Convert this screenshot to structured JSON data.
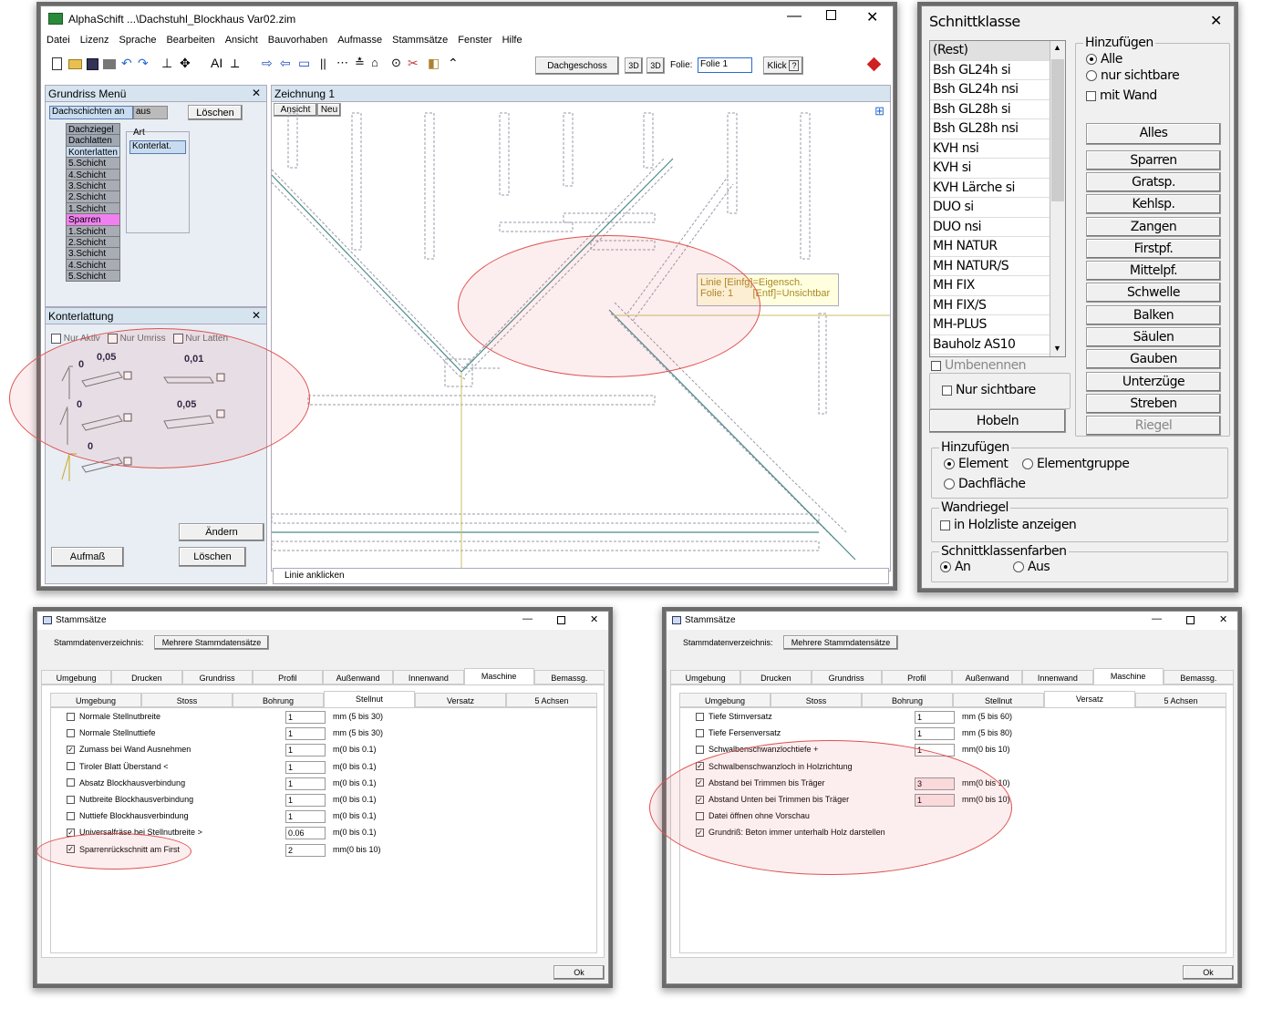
{
  "main": {
    "title": "AlphaSchift ...\\Dachstuhl_Blockhaus Var02.zim",
    "menu": [
      "Datei",
      "Lizenz",
      "Sprache",
      "Bearbeiten",
      "Ansicht",
      "Bauvorhaben",
      "Aufmasse",
      "Stammsätze",
      "Fenster",
      "Hilfe"
    ],
    "toolbar": {
      "floor": "Dachgeschoss",
      "btn3d1": "3D",
      "btn3d2": "3D",
      "folie_label": "Folie:",
      "folie_value": "Folie 1",
      "klick": "Klick",
      "help": "?"
    },
    "grundriss": {
      "title": "Grundriss Menü",
      "dachschichten": "Dachschichten an",
      "aus": "aus",
      "loeschen": "Löschen",
      "layers": [
        "Dachziegel",
        "Dachlatten",
        "Konterlatten",
        "5.Schicht",
        "4.Schicht",
        "3.Schicht",
        "2.Schicht",
        "1.Schicht",
        "Sparren",
        "1.Schicht",
        "2.Schicht",
        "3.Schicht",
        "4.Schicht",
        "5.Schicht"
      ],
      "art_label": "Art",
      "art_value": "Konterlat."
    },
    "konter": {
      "title": "Konterlattung",
      "nur_aktiv": "Nur Aktiv",
      "nur_umriss": "Nur Umriss",
      "nur_latten": "Nur Latten",
      "vals": [
        "0",
        "0,05",
        "0,01",
        "0",
        "0,05",
        "0"
      ],
      "aendern": "Ändern",
      "aufmass": "Aufmaß",
      "loeschen": "Löschen"
    },
    "zeichnung": {
      "title": "Zeichnung 1",
      "ansicht": "Ansicht",
      "neu": "Neu",
      "tip1": "Linie  [Einfg]=Eigensch.",
      "tip2": "Folie: 1       [Entf]=Unsichtbar",
      "status": "Linie anklicken"
    }
  },
  "schnitt": {
    "title": "Schnittklasse",
    "items": [
      "(Rest)",
      "Bsh GL24h si",
      "Bsh GL24h nsi",
      "Bsh GL28h si",
      "Bsh GL28h nsi",
      "KVH nsi",
      "KVH si",
      "KVH Lärche si",
      "DUO si",
      "DUO nsi",
      "MH NATUR",
      "MH NATUR/S",
      "MH FIX",
      "MH FIX/S",
      "MH-PLUS",
      "Bauholz AS10"
    ],
    "hinzufuegen": "Hinzufügen",
    "alle": "Alle",
    "nur_sichtbare": "nur sichtbare",
    "mit_wand": "mit Wand",
    "buttons": [
      "Alles",
      "Sparren",
      "Gratsp.",
      "Kehlsp.",
      "Zangen",
      "Firstpf.",
      "Mittelpf.",
      "Schwelle",
      "Balken",
      "Säulen",
      "Gauben",
      "Unterzüge",
      "Streben",
      "Riegel"
    ],
    "umbenennen": "Umbenennen",
    "nur_sichtbare2": "Nur sichtbare",
    "hobeln": "Hobeln",
    "hinz2": "Hinzufügen",
    "element": "Element",
    "elementgruppe": "Elementgruppe",
    "dachflaeche": "Dachfläche",
    "wandriegel": "Wandriegel",
    "holzliste": "in Holzliste anzeigen",
    "farben": "Schnittklassenfarben",
    "an": "An",
    "aus": "Aus"
  },
  "stamm1": {
    "title": "Stammsätze",
    "verz": "Stammdatenverzeichnis:",
    "mehrere": "Mehrere Stammdatensätze",
    "tabs": [
      "Umgebung",
      "Drucken",
      "Grundriss",
      "Profil",
      "Außenwand",
      "Innenwand",
      "Maschine",
      "Bemassg."
    ],
    "subtabs": [
      "Umgebung",
      "Stoss",
      "Bohrung",
      "Stellnut",
      "Versatz",
      "5 Achsen"
    ],
    "rows": [
      {
        "label": "Normale Stellnutbreite",
        "checked": "",
        "value": "1",
        "unit": "mm (5 bis 30)"
      },
      {
        "label": "Normale Stellnuttiefe",
        "checked": "",
        "value": "1",
        "unit": "mm (5 bis 30)"
      },
      {
        "label": "Zumass bei Wand Ausnehmen",
        "checked": "✓",
        "value": "1",
        "unit": "m(0 bis 0.1)"
      },
      {
        "label": "Tiroler Blatt  Überstand <",
        "checked": "",
        "value": "1",
        "unit": "m(0 bis 0.1)"
      },
      {
        "label": "Absatz Blockhausverbindung",
        "checked": "",
        "value": "1",
        "unit": "m(0 bis 0.1)"
      },
      {
        "label": "Nutbreite Blockhausverbindung",
        "checked": "",
        "value": "1",
        "unit": "m(0 bis 0.1)"
      },
      {
        "label": "Nuttiefe Blockhausverbindung",
        "checked": "",
        "value": "1",
        "unit": "m(0 bis 0.1)"
      },
      {
        "label": "Universalfräse bei Stellnutbreite >",
        "checked": "✓",
        "value": "0.06",
        "unit": "m(0 bis 0.1)"
      },
      {
        "label": "Sparrenrückschnitt am First",
        "checked": "✓",
        "value": "2",
        "unit": "mm(0 bis 10)"
      }
    ],
    "ok": "Ok"
  },
  "stamm2": {
    "title": "Stammsätze",
    "verz": "Stammdatenverzeichnis:",
    "mehrere": "Mehrere Stammdatensätze",
    "tabs": [
      "Umgebung",
      "Drucken",
      "Grundriss",
      "Profil",
      "Außenwand",
      "Innenwand",
      "Maschine",
      "Bemassg."
    ],
    "subtabs": [
      "Umgebung",
      "Stoss",
      "Bohrung",
      "Stellnut",
      "Versatz",
      "5 Achsen"
    ],
    "rows": [
      {
        "label": "Tiefe Stirnversatz",
        "checked": "",
        "value": "1",
        "unit": "mm (5 bis 60)"
      },
      {
        "label": "Tiefe Fersenversatz",
        "checked": "",
        "value": "1",
        "unit": "mm (5 bis 80)"
      },
      {
        "label": "Schwalbenschwanzlochtiefe +",
        "checked": "",
        "value": "1",
        "unit": "mm(0 bis 10)"
      },
      {
        "label": "Schwalbenschwanzloch in Holzrichtung",
        "checked": "✓",
        "value": "",
        "unit": ""
      },
      {
        "label": "Abstand bei Trimmen bis Träger",
        "checked": "✓",
        "value": "3",
        "unit": "mm(0 bis 10)"
      },
      {
        "label": "Abstand Unten bei Trimmen bis Träger",
        "checked": "✓",
        "value": "1",
        "unit": "mm(0 bis 10)"
      },
      {
        "label": "Datei öffnen ohne Vorschau",
        "checked": "",
        "value": "",
        "unit": ""
      },
      {
        "label": "Grundriß: Beton immer unterhalb Holz darstellen",
        "checked": "✓",
        "value": "",
        "unit": ""
      }
    ],
    "ok": "Ok"
  }
}
